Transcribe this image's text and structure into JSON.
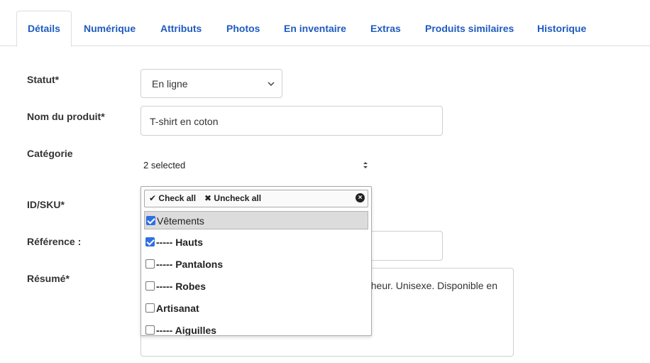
{
  "tabs": [
    {
      "label": "Détails",
      "active": true
    },
    {
      "label": "Numérique"
    },
    {
      "label": "Attributs"
    },
    {
      "label": "Photos"
    },
    {
      "label": "En inventaire"
    },
    {
      "label": "Extras"
    },
    {
      "label": "Produits similaires"
    },
    {
      "label": "Historique"
    }
  ],
  "form": {
    "statut_label": "Statut*",
    "statut_value": "En ligne",
    "nom_label": "Nom du produit*",
    "nom_value": "T-shirt en coton",
    "categorie_label": "Catégorie",
    "categorie_value": "2 selected",
    "sku_label": "ID/SKU*",
    "reference_label": "Référence :",
    "resume_label": "Résumé*",
    "resume_value": "cheur. Unisexe. Disponible en"
  },
  "dropdown": {
    "check_all": "Check all",
    "uncheck_all": "Uncheck all",
    "items": [
      {
        "label": "Vêtements",
        "checked": true
      },
      {
        "label": "----- Hauts",
        "checked": true
      },
      {
        "label": "----- Pantalons",
        "checked": false
      },
      {
        "label": "----- Robes",
        "checked": false
      },
      {
        "label": "Artisanat",
        "checked": false
      },
      {
        "label": "----- Aiguilles",
        "checked": false
      }
    ]
  },
  "colors": {
    "tab_link": "#1f5bbf",
    "checkbox_checked": "#2f6fe4"
  }
}
